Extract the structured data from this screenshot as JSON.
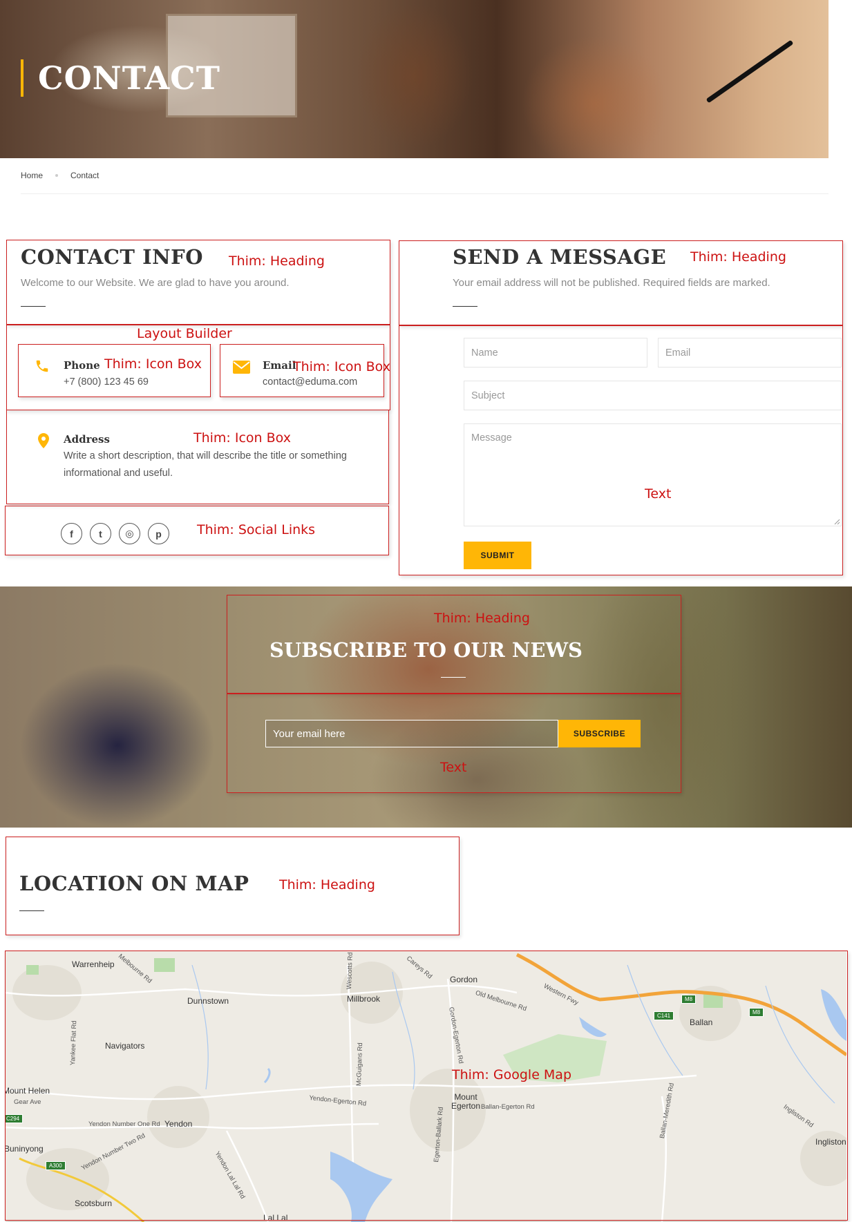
{
  "hero": {
    "title": "CONTACT"
  },
  "breadcrumb": {
    "items": [
      "Home",
      "Contact"
    ]
  },
  "contact_info": {
    "title": "CONTACT INFO",
    "subtitle": "Welcome to our Website. We are glad to have you around.",
    "phone": {
      "label": "Phone",
      "value": "+7 (800) 123 45 69",
      "icon": "phone-icon"
    },
    "email": {
      "label": "Email",
      "value": "contact@eduma.com",
      "icon": "envelope-icon"
    },
    "address": {
      "label": "Address",
      "value_line1": "Write a short description, that will describe the title or something",
      "value_line2": "informational and useful.",
      "icon": "map-pin-icon"
    },
    "social": [
      {
        "name": "facebook-icon",
        "glyph": "f"
      },
      {
        "name": "twitter-icon",
        "glyph": "t"
      },
      {
        "name": "dribbble-icon",
        "glyph": "◎"
      },
      {
        "name": "pinterest-icon",
        "glyph": "p"
      }
    ]
  },
  "send_message": {
    "title": "SEND A MESSAGE",
    "subtitle": "Your email address will not be published. Required fields are marked.",
    "name_placeholder": "Name",
    "email_placeholder": "Email",
    "subject_placeholder": "Subject",
    "message_placeholder": "Message",
    "submit_label": "SUBMIT"
  },
  "subscribe": {
    "title": "SUBSCRIBE TO OUR NEWS",
    "email_placeholder": "Your email here",
    "button_label": "SUBSCRIBE"
  },
  "location": {
    "title": "LOCATION ON MAP"
  },
  "map": {
    "labels": [
      "Warrenheip",
      "Dunnstown",
      "Millbrook",
      "Gordon",
      "Ballan",
      "Navigators",
      "Mount Egerton",
      "Yendon",
      "Ingliston",
      "Scotsburn",
      "Lal Lal",
      "Mount Helen",
      "Buninyong"
    ],
    "road_labels": [
      "Western Fwy",
      "Old Melbourne Rd",
      "Ballan-Egerton Rd",
      "Yendon-Egerton Rd",
      "Yendon Number One Rd",
      "Yendon Number Two Rd",
      "Yendon Lal Lal Rd",
      "Gordon-Egerton Rd",
      "Ballan-Meredith Rd",
      "Ingliston Rd",
      "McGuigans Rd",
      "Wescotts Rd",
      "Careys Rd",
      "Yankee Flat Rd",
      "Egerton-Ballark Rd",
      "Gear Ave",
      "Melbourne Rd"
    ],
    "shields": [
      "M8",
      "M8",
      "C141",
      "A300",
      "C294"
    ]
  },
  "annotations": {
    "contact_heading": "Thim: Heading",
    "send_heading": "Thim: Heading",
    "layout_builder": "Layout Builder",
    "phone_box": "Thim: Icon Box",
    "email_box": "Thim: Icon Box",
    "address_box": "Thim: Icon Box",
    "social_links": "Thim: Social Links",
    "form_text": "Text",
    "subscribe_heading": "Thim: Heading",
    "subscribe_text": "Text",
    "location_heading": "Thim: Heading",
    "google_map": "Thim: Google Map"
  },
  "colors": {
    "accent": "#ffb606",
    "annotation": "#cc1f1f"
  }
}
